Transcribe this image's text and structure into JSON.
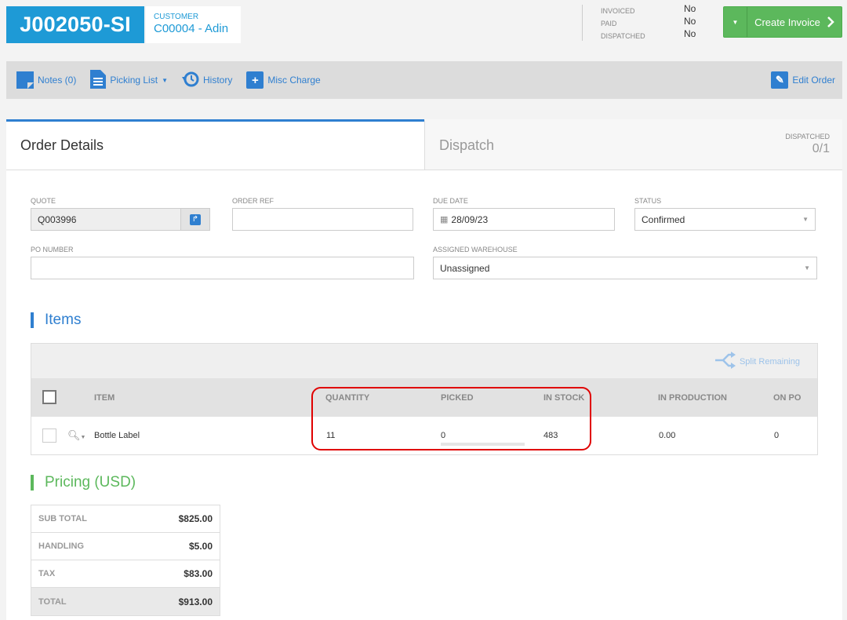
{
  "header": {
    "order_id": "J002050-SI",
    "customer_label": "CUSTOMER",
    "customer_value": "C00004 - Adin",
    "statuses": [
      {
        "label": "INVOICED",
        "value": "No"
      },
      {
        "label": "PAID",
        "value": "No"
      },
      {
        "label": "DISPATCHED",
        "value": "No"
      }
    ],
    "create_invoice_label": "Create Invoice"
  },
  "toolbar": {
    "notes_label": "Notes (0)",
    "picking_list_label": "Picking List",
    "history_label": "History",
    "misc_charge_label": "Misc Charge",
    "edit_order_label": "Edit Order"
  },
  "tabs": {
    "order_details": "Order Details",
    "dispatch": "Dispatch",
    "dispatched_label": "DISPATCHED",
    "dispatched_value": "0/1"
  },
  "form": {
    "quote_label": "QUOTE",
    "quote_value": "Q003996",
    "order_ref_label": "ORDER REF",
    "order_ref_value": "",
    "due_date_label": "DUE DATE",
    "due_date_value": "28/09/23",
    "status_label": "STATUS",
    "status_value": "Confirmed",
    "po_number_label": "PO NUMBER",
    "po_number_value": "",
    "warehouse_label": "ASSIGNED WAREHOUSE",
    "warehouse_value": "Unassigned"
  },
  "items": {
    "title": "Items",
    "split_remaining_label": "Split Remaining",
    "columns": {
      "item": "ITEM",
      "quantity": "QUANTITY",
      "picked": "PICKED",
      "in_stock": "IN STOCK",
      "in_production": "IN PRODUCTION",
      "on_po": "ON PO"
    },
    "rows": [
      {
        "item": "Bottle Label",
        "quantity": "11",
        "picked": "0",
        "in_stock": "483",
        "in_production": "0.00",
        "on_po": "0"
      }
    ]
  },
  "pricing": {
    "title": "Pricing (USD)",
    "rows": [
      {
        "label": "SUB TOTAL",
        "value": "$825.00"
      },
      {
        "label": "HANDLING",
        "value": "$5.00"
      },
      {
        "label": "TAX",
        "value": "$83.00"
      },
      {
        "label": "TOTAL",
        "value": "$913.00"
      }
    ]
  },
  "colors": {
    "brand_blue": "#1e9ad6",
    "link_blue": "#2f7fd0",
    "success_green": "#5cb85c",
    "pricing_green": "#5cb85c",
    "highlight_red": "#e00000"
  }
}
